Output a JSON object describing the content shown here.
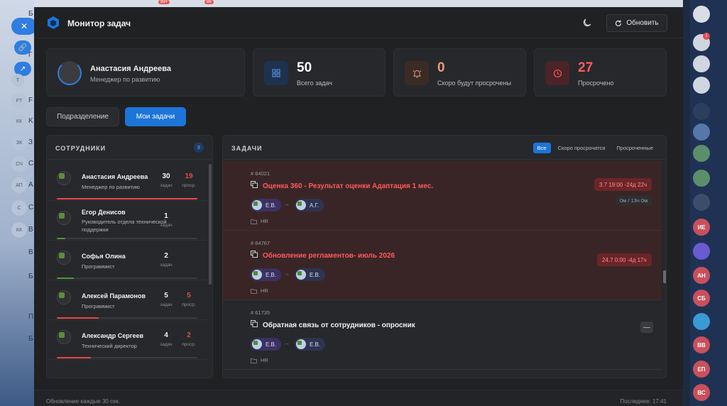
{
  "header": {
    "title": "Монитор задач",
    "refresh_label": "Обновить"
  },
  "profile": {
    "name": "Анастасия Андреева",
    "role": "Менеджер по развитию"
  },
  "stats": [
    {
      "value": "50",
      "label": "Всего задач",
      "color": "#ffffff",
      "icon": "grid-icon"
    },
    {
      "value": "0",
      "label": "Скоро будут просрочены",
      "color": "#e89a78",
      "icon": "bell-alert-icon"
    },
    {
      "value": "27",
      "label": "Просрочено",
      "color": "#ff5a5f",
      "icon": "clock-icon"
    }
  ],
  "view_tabs": {
    "department": "Подразделение",
    "my_tasks": "Мои задачи"
  },
  "employees_panel": {
    "title": "СОТРУДНИКИ",
    "count": "9",
    "items": [
      {
        "name": "Анастасия Андреева",
        "role": "Менеджер по развитию",
        "tasks": "30",
        "tasks_label": "задач",
        "overdue": "19",
        "overdue_label": "проср.",
        "progress": 1.0,
        "bar_color": "#e8474b"
      },
      {
        "name": "Егор Денисов",
        "role": "Руководитель отдела технической поддержки",
        "tasks": "1",
        "tasks_label": "задач",
        "overdue": "",
        "overdue_label": "",
        "progress": 0.06,
        "bar_color": "#4a9a3a"
      },
      {
        "name": "Софья Олина",
        "role": "Программист",
        "tasks": "2",
        "tasks_label": "задач",
        "overdue": "",
        "overdue_label": "",
        "progress": 0.12,
        "bar_color": "#4a9a3a"
      },
      {
        "name": "Алексей Парамонов",
        "role": "Программист",
        "tasks": "5",
        "tasks_label": "задач",
        "overdue": "5",
        "overdue_label": "проср.",
        "progress": 0.3,
        "bar_color": "#e8474b"
      },
      {
        "name": "Александр Сергеев",
        "role": "Технический директор",
        "tasks": "4",
        "tasks_label": "задач",
        "overdue": "2",
        "overdue_label": "проср.",
        "progress": 0.24,
        "bar_color": "#e8474b"
      }
    ]
  },
  "tasks_panel": {
    "title": "ЗАДАЧИ",
    "filters": [
      "Все",
      "Скоро просрочатся",
      "Просроченные"
    ],
    "items": [
      {
        "id": "64021",
        "title": "Оценка 360 - Результат оценки Адаптация 1 мес.",
        "overdue": true,
        "from": "Е.В.",
        "to": "А.Г.",
        "dept": "HR",
        "due": "3.7 19:00 -24д 22ч",
        "time": "0м / 13ч 0м"
      },
      {
        "id": "64767",
        "title": "Обновление регламентов- июль 2026",
        "overdue": true,
        "from": "Е.В.",
        "to": "Е.В.",
        "dept": "HR",
        "due": "24.7 0:00 -4д 17ч",
        "time": ""
      },
      {
        "id": "61735",
        "title": "Обратная связь от сотрудников - опросник",
        "overdue": false,
        "from": "Е.В.",
        "to": "Е.В.",
        "dept": "HR",
        "due": "",
        "time": ""
      }
    ]
  },
  "footer": {
    "left": "Обновление каждые 30 сек.",
    "right": "Последнее: 17:41"
  },
  "background_app": {
    "badges": [
      "99+",
      "86"
    ],
    "left_items": [
      "T",
      "FT",
      "КК",
      "ЗК",
      "СЧ",
      "АП",
      "С",
      "КК"
    ],
    "left_labels": [
      "Б",
      "Г",
      "F",
      "K",
      "З",
      "C",
      "A",
      "C",
      "B",
      "B",
      "Б",
      "П",
      "Б"
    ],
    "rail_items": [
      {
        "label": "",
        "color": "#d8dde6"
      },
      {
        "label": "",
        "color": "#cfd6e2"
      },
      {
        "label": "",
        "color": "#cfd6e2"
      },
      {
        "label": "",
        "color": "#cfd6e2"
      },
      {
        "label": "",
        "color": "#2c3e5e"
      },
      {
        "label": "",
        "color": "#5577aa"
      },
      {
        "label": "",
        "color": "#5b8f6b"
      },
      {
        "label": "",
        "color": "#5b8f6b"
      },
      {
        "label": "",
        "color": "#3c4d6b"
      },
      {
        "label": "ИЕ",
        "color": "#c9505b"
      },
      {
        "label": "",
        "color": "#6c5bd0"
      },
      {
        "label": "АН",
        "color": "#c9505b"
      },
      {
        "label": "СБ",
        "color": "#c9505b"
      },
      {
        "label": "",
        "color": "#3a9ad6"
      },
      {
        "label": "ВВ",
        "color": "#c9505b"
      },
      {
        "label": "ЕП",
        "color": "#c9505b"
      },
      {
        "label": "ВС",
        "color": "#c9505b"
      }
    ],
    "notification_count": "1"
  }
}
